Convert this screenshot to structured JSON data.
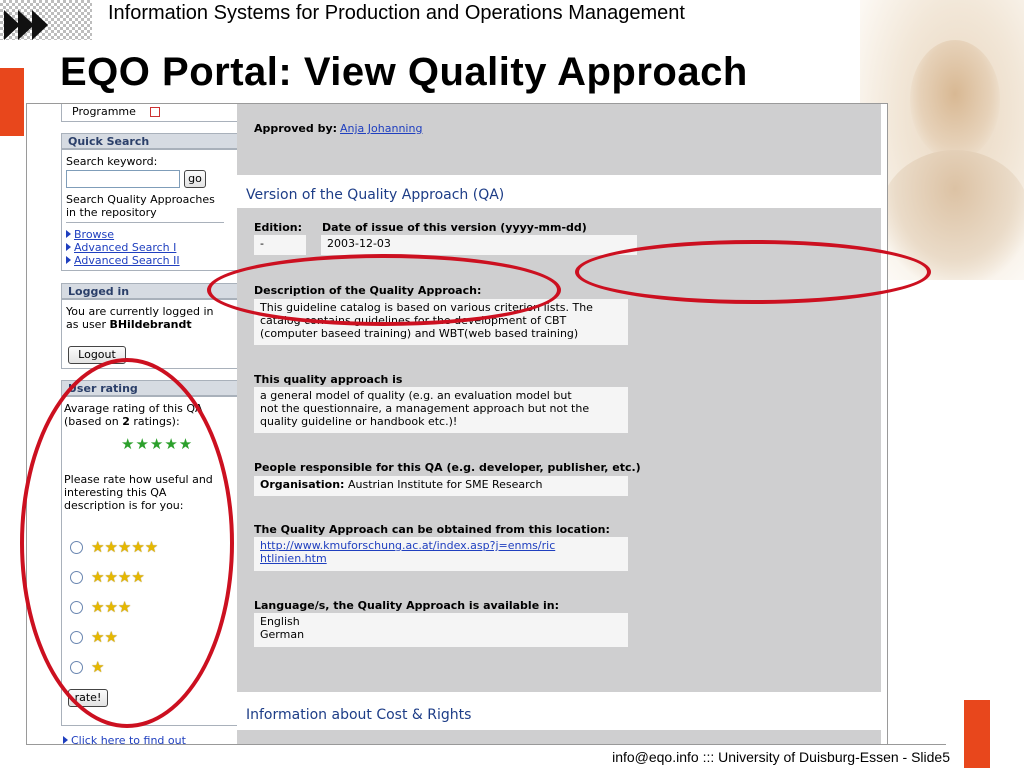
{
  "slide": {
    "header": "Information Systems for Production and Operations Management",
    "title": "EQO Portal: View Quality Approach",
    "footer": "info@eqo.info ::: University of Duisburg-Essen - Slide5"
  },
  "sidebar": {
    "programme": "Programme",
    "quick_search": {
      "title": "Quick Search",
      "label": "Search keyword:",
      "go": "go",
      "hint_line1": "Search Quality Approaches",
      "hint_line2": "in the repository",
      "links": [
        "Browse",
        "Advanced Search I",
        "Advanced Search II"
      ]
    },
    "logged_in": {
      "title": "Logged in",
      "line1": "You are currently logged in",
      "line2_prefix": "as user",
      "user": "BHildebrandt",
      "logout": "Logout"
    },
    "rating": {
      "title": "User rating",
      "avg_line1": "Avarage rating of this QA",
      "avg_line2_prefix": "(based on",
      "avg_count": "2",
      "avg_line2_suffix": "ratings):",
      "avg_stars": "★★★★★",
      "prompt_line1": "Please rate how useful and",
      "prompt_line2": "interesting this QA",
      "prompt_line3": "description is for you:",
      "options": [
        "★★★★★",
        "★★★★",
        "★★★",
        "★★",
        "★"
      ],
      "rate_button": "rate!"
    },
    "find_out": "Click here to find out"
  },
  "main": {
    "approved_label": "Approved by:",
    "approved_value": "Anja Johanning",
    "version_heading": "Version of the Quality Approach (QA)",
    "edition_label": "Edition:",
    "date_label": "Date of issue of this version (yyyy-mm-dd)",
    "edition_value": "-",
    "date_value": "2003-12-03",
    "description_label": "Description of the Quality Approach:",
    "description_value": [
      "This guideline catalog is based on various criterion lists. The",
      "catalog contains guidelines for the development of CBT",
      "(computer baseed training) and WBT(web based training)"
    ],
    "this_qa_label": "This quality approach is",
    "this_qa_value": [
      "a general model of quality (e.g. an evaluation model but",
      "not the questionnaire, a management approach but not the",
      "quality guideline or handbook etc.)!"
    ],
    "people_label": "People responsible for this QA (e.g. developer, publisher, etc.)",
    "organisation_label": "Organisation:",
    "organisation_value": "Austrian Institute for SME Research",
    "location_label": "The Quality Approach can be obtained from this location:",
    "location_line1": "http://www.kmuforschung.ac.at/index.asp?j=enms/ric",
    "location_line2": "htlinien.htm",
    "language_label": "Language/s, the Quality Approach is available in:",
    "languages": [
      "English",
      "German"
    ],
    "cost_heading": "Information about Cost & Rights"
  },
  "colors": {
    "accent_red": "#e8471c",
    "annotation_red": "#cc1020",
    "link_blue": "#1f3fbf",
    "heading_blue": "#1d3d87"
  }
}
